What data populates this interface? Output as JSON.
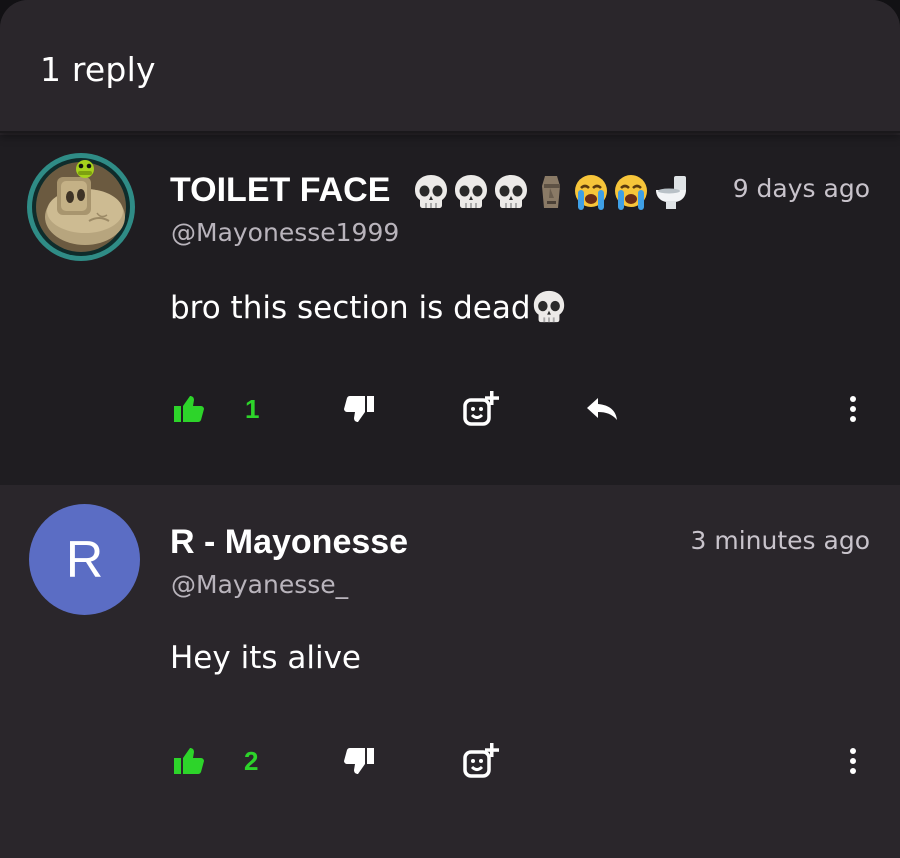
{
  "header": {
    "title": "1 reply"
  },
  "colors": {
    "like_active": "#2dd42a",
    "reply_avatar_bg": "#5b6dc4"
  },
  "comments": [
    {
      "display_name": "TOILET FACE",
      "name_emojis": [
        "skull-emoji",
        "skull-emoji",
        "skull-emoji",
        "moai-emoji",
        "loudly-crying-emoji",
        "loudly-crying-emoji",
        "toilet-emoji"
      ],
      "handle": "@Mayonesse1999",
      "time": "9 days ago",
      "text": "bro this section is dead",
      "text_emoji": "skull-emoji",
      "likes": "1",
      "actions": [
        "thumbs-up-icon",
        "thumbs-down-icon",
        "add-reaction-icon",
        "reply-icon",
        "more-vertical-icon"
      ]
    },
    {
      "avatar_letter": "R",
      "display_name": "R - Mayonesse",
      "handle": "@Mayanesse_",
      "time": "3 minutes ago",
      "text": "Hey its alive",
      "likes": "2",
      "actions": [
        "thumbs-up-icon",
        "thumbs-down-icon",
        "add-reaction-icon",
        "more-vertical-icon"
      ]
    }
  ]
}
